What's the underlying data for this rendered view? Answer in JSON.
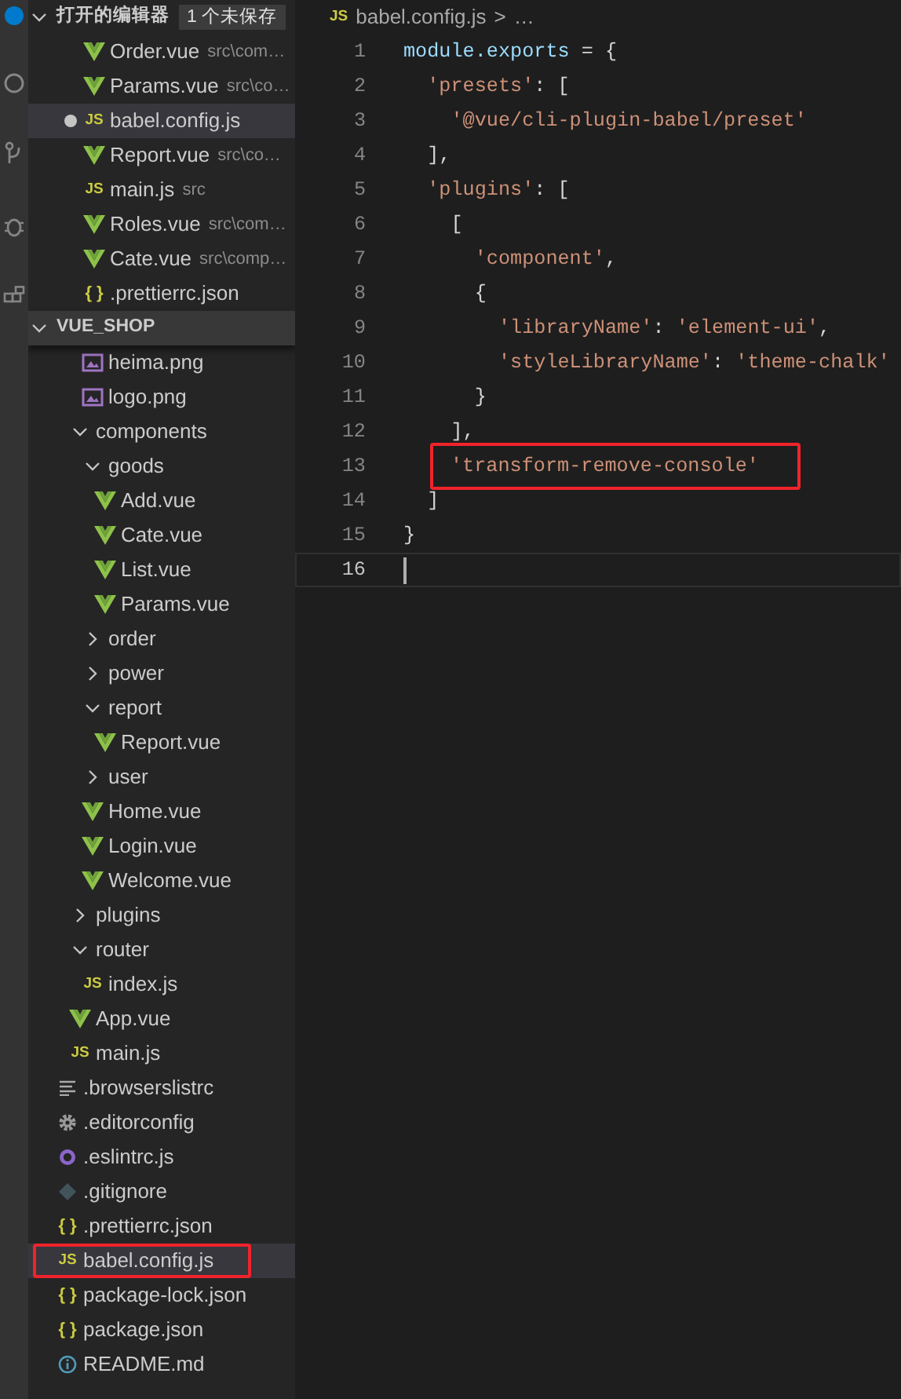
{
  "activity_bar": {
    "badge": true
  },
  "open_editors": {
    "title": "打开的编辑器",
    "unsaved": "1 个未保存",
    "items": [
      {
        "name": "Order.vue",
        "path": "src\\com…",
        "kind": "vue",
        "dirty": false,
        "selected": false
      },
      {
        "name": "Params.vue",
        "path": "src\\co…",
        "kind": "vue",
        "dirty": false,
        "selected": false
      },
      {
        "name": "babel.config.js",
        "kind": "js",
        "badge": "JS",
        "dirty": true,
        "selected": true
      },
      {
        "name": "Report.vue",
        "path": "src\\co…",
        "kind": "vue",
        "dirty": false,
        "selected": false
      },
      {
        "name": "main.js",
        "path": "src",
        "kind": "js",
        "badge": "JS",
        "dirty": false,
        "selected": false
      },
      {
        "name": "Roles.vue",
        "path": "src\\com…",
        "kind": "vue",
        "dirty": false,
        "selected": false
      },
      {
        "name": "Cate.vue",
        "path": "src\\comp…",
        "kind": "vue",
        "dirty": false,
        "selected": false
      },
      {
        "name": ".prettierrc.json",
        "kind": "json",
        "badge": "{ }",
        "dirty": false,
        "selected": false
      }
    ]
  },
  "explorer": {
    "title": "VUE_SHOP",
    "items": [
      {
        "children": [
          {
            "children": [
              {
                "label": "heima.png",
                "kind": "image",
                "selected": false,
                "boxed": false
              },
              {
                "label": "logo.png",
                "kind": "image",
                "selected": false,
                "boxed": false
              }
            ]
          },
          {
            "label": "components",
            "kind": "folder",
            "expanded": true,
            "selected": false,
            "boxed": false,
            "children": [
              {
                "label": "goods",
                "kind": "folder",
                "expanded": true,
                "selected": false,
                "boxed": false,
                "children": [
                  {
                    "label": "Add.vue",
                    "kind": "vue",
                    "selected": false,
                    "boxed": false
                  },
                  {
                    "label": "Cate.vue",
                    "kind": "vue",
                    "selected": false,
                    "boxed": false
                  },
                  {
                    "label": "List.vue",
                    "kind": "vue",
                    "selected": false,
                    "boxed": false
                  },
                  {
                    "label": "Params.vue",
                    "kind": "vue",
                    "selected": false,
                    "boxed": false
                  }
                ]
              },
              {
                "label": "order",
                "kind": "folder",
                "expanded": false,
                "selected": false,
                "boxed": false
              },
              {
                "label": "power",
                "kind": "folder",
                "expanded": false,
                "selected": false,
                "boxed": false
              },
              {
                "label": "report",
                "kind": "folder",
                "expanded": true,
                "selected": false,
                "boxed": false,
                "children": [
                  {
                    "label": "Report.vue",
                    "kind": "vue",
                    "selected": false,
                    "boxed": false
                  }
                ]
              },
              {
                "label": "user",
                "kind": "folder",
                "expanded": false,
                "selected": false,
                "boxed": false
              },
              {
                "label": "Home.vue",
                "kind": "vue",
                "selected": false,
                "boxed": false
              },
              {
                "label": "Login.vue",
                "kind": "vue",
                "selected": false,
                "boxed": false
              },
              {
                "label": "Welcome.vue",
                "kind": "vue",
                "selected": false,
                "boxed": false
              }
            ]
          },
          {
            "label": "plugins",
            "kind": "folder",
            "expanded": false,
            "selected": false,
            "boxed": false
          },
          {
            "label": "router",
            "kind": "folder",
            "expanded": true,
            "selected": false,
            "boxed": false,
            "children": [
              {
                "label": "index.js",
                "kind": "js",
                "badge": "JS",
                "selected": false,
                "boxed": false
              }
            ]
          },
          {
            "label": "App.vue",
            "kind": "vue",
            "selected": false,
            "boxed": false
          },
          {
            "label": "main.js",
            "kind": "js",
            "badge": "JS",
            "selected": false,
            "boxed": false
          }
        ]
      },
      {
        "label": ".browserslistrc",
        "kind": "lines",
        "selected": false,
        "boxed": false
      },
      {
        "label": ".editorconfig",
        "kind": "gear",
        "selected": false,
        "boxed": false
      },
      {
        "label": ".eslintrc.js",
        "kind": "eslint",
        "selected": false,
        "boxed": false
      },
      {
        "label": ".gitignore",
        "kind": "git",
        "selected": false,
        "boxed": false
      },
      {
        "label": ".prettierrc.json",
        "kind": "json",
        "badge": "{ }",
        "selected": false,
        "boxed": false
      },
      {
        "label": "babel.config.js",
        "kind": "js",
        "badge": "JS",
        "selected": true,
        "boxed": true
      },
      {
        "label": "package-lock.json",
        "kind": "json",
        "badge": "{ }",
        "selected": false,
        "boxed": false
      },
      {
        "label": "package.json",
        "kind": "json",
        "badge": "{ }",
        "selected": false,
        "boxed": false
      },
      {
        "label": "README.md",
        "kind": "info",
        "selected": false,
        "boxed": false
      }
    ]
  },
  "breadcrumb": {
    "badge": "JS",
    "file": "babel.config.js",
    "separator": ">",
    "more": "…"
  },
  "code": [
    {
      "number": "1",
      "current": false,
      "boxed": false,
      "tokens": [
        {
          "text": "module.exports",
          "kind": "var"
        },
        {
          "text": " = {",
          "kind": "punct"
        }
      ]
    },
    {
      "number": "2",
      "current": false,
      "boxed": false,
      "tokens": [
        {
          "text": "  'presets'",
          "kind": "str"
        },
        {
          "text": ": [",
          "kind": "punct"
        }
      ]
    },
    {
      "number": "3",
      "current": false,
      "boxed": false,
      "tokens": [
        {
          "text": "    '@vue/cli-plugin-babel/preset'",
          "kind": "str"
        }
      ]
    },
    {
      "number": "4",
      "current": false,
      "boxed": false,
      "tokens": [
        {
          "text": "  ],",
          "kind": "punct"
        }
      ]
    },
    {
      "number": "5",
      "current": false,
      "boxed": false,
      "tokens": [
        {
          "text": "  'plugins'",
          "kind": "str"
        },
        {
          "text": ": [",
          "kind": "punct"
        }
      ]
    },
    {
      "number": "6",
      "current": false,
      "boxed": false,
      "tokens": [
        {
          "text": "    [",
          "kind": "punct"
        }
      ]
    },
    {
      "number": "7",
      "current": false,
      "boxed": false,
      "tokens": [
        {
          "text": "      'component'",
          "kind": "str"
        },
        {
          "text": ",",
          "kind": "punct"
        }
      ]
    },
    {
      "number": "8",
      "current": false,
      "boxed": false,
      "tokens": [
        {
          "text": "      {",
          "kind": "punct"
        }
      ]
    },
    {
      "number": "9",
      "current": false,
      "boxed": false,
      "tokens": [
        {
          "text": "        'libraryName'",
          "kind": "str"
        },
        {
          "text": ": ",
          "kind": "punct"
        },
        {
          "text": "'element-ui'",
          "kind": "str"
        },
        {
          "text": ",",
          "kind": "punct"
        }
      ]
    },
    {
      "number": "10",
      "current": false,
      "boxed": false,
      "tokens": [
        {
          "text": "        'styleLibraryName'",
          "kind": "str"
        },
        {
          "text": ": ",
          "kind": "punct"
        },
        {
          "text": "'theme-chalk'",
          "kind": "str"
        }
      ]
    },
    {
      "number": "11",
      "current": false,
      "boxed": false,
      "tokens": [
        {
          "text": "      }",
          "kind": "punct"
        }
      ]
    },
    {
      "number": "12",
      "current": false,
      "boxed": false,
      "tokens": [
        {
          "text": "    ],",
          "kind": "punct"
        }
      ]
    },
    {
      "number": "13",
      "current": false,
      "boxed": true,
      "tokens": [
        {
          "text": "'transform-remove-console'",
          "kind": "str"
        }
      ]
    },
    {
      "number": "14",
      "current": false,
      "boxed": false,
      "tokens": [
        {
          "text": "  ]",
          "kind": "punct"
        }
      ]
    },
    {
      "number": "15",
      "current": false,
      "boxed": false,
      "tokens": [
        {
          "text": "}",
          "kind": "punct"
        }
      ]
    },
    {
      "number": "16",
      "current": true,
      "boxed": false
    }
  ]
}
